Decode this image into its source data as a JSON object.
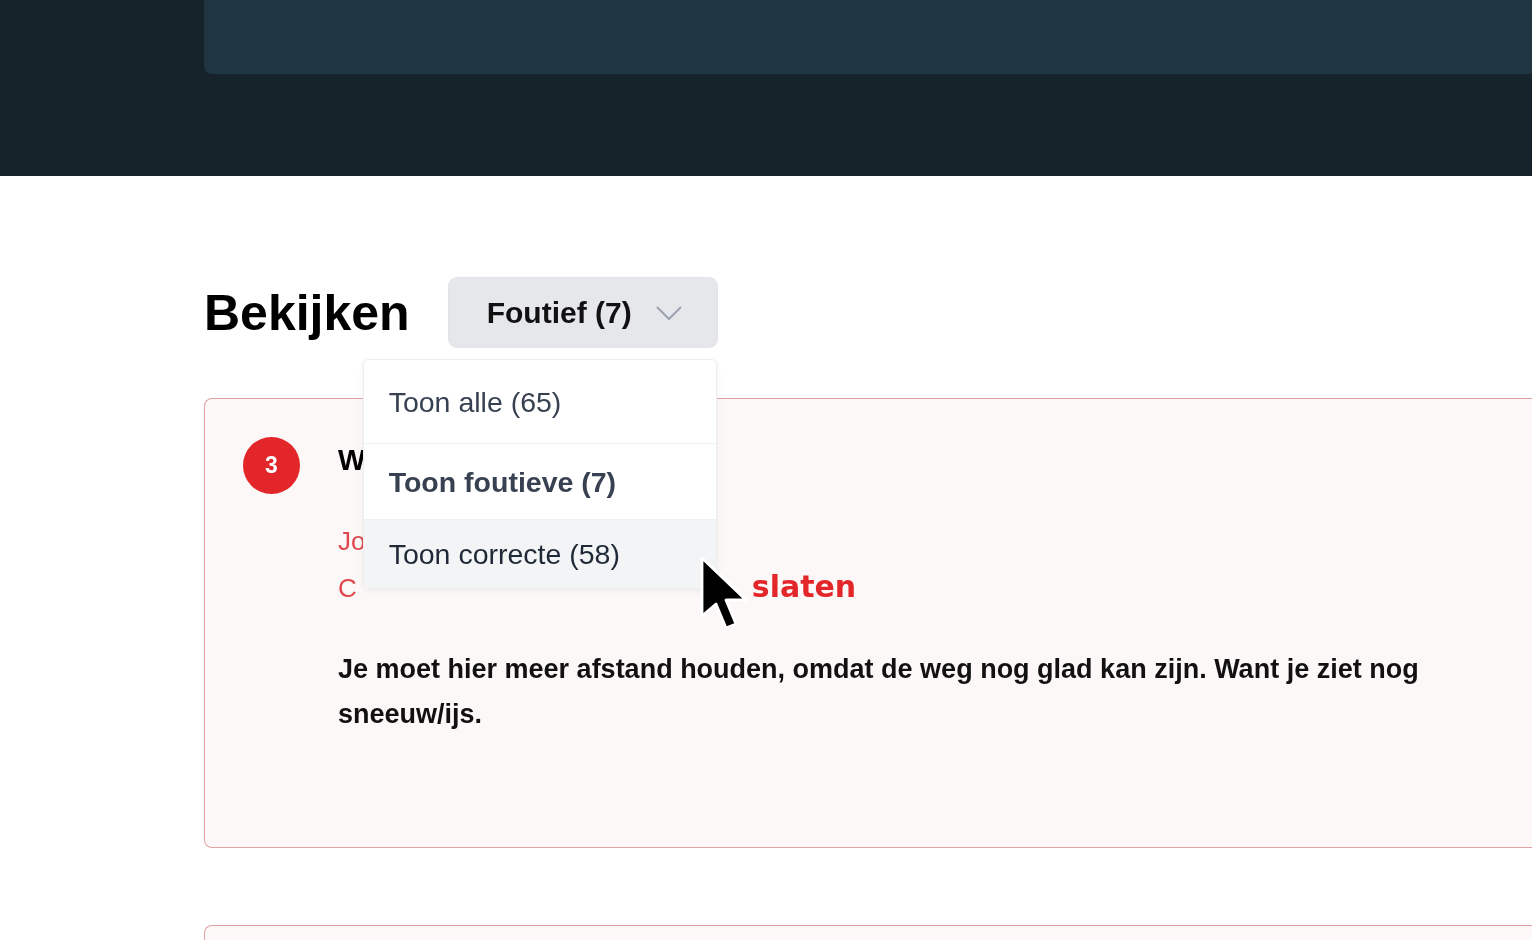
{
  "review": {
    "title": "Bekijken",
    "filter": {
      "label": "Foutief (7)",
      "expanded": true,
      "options": [
        {
          "label": "Toon alle (65)",
          "selected": false,
          "hovered": false
        },
        {
          "label": "Toon foutieve (7)",
          "selected": true,
          "hovered": false
        },
        {
          "label": "Toon correcte (58)",
          "selected": false,
          "hovered": true
        }
      ]
    }
  },
  "questions": [
    {
      "correct": false,
      "number": "3",
      "question": "W",
      "your_answer": "Jo",
      "correct_answer_label": "C",
      "correct_answer": "slaten",
      "explanation": "Je moet hier meer afstand houden, omdat de weg nog glad kan zijn. Want je ziet nog sneeuw/ijs."
    },
    {
      "correct": false
    }
  ]
}
